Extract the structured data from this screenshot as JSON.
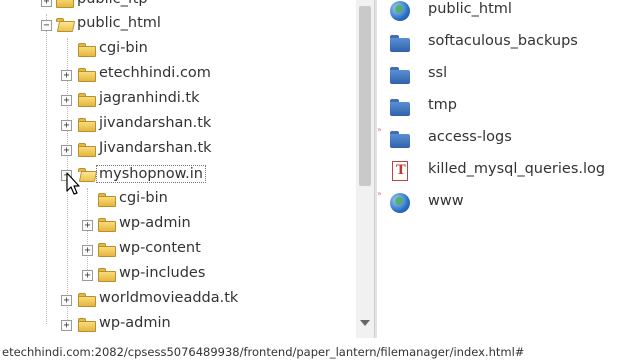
{
  "tree": {
    "items": [
      {
        "label": "public_ftp",
        "expander": "+",
        "open": false,
        "selected": false
      },
      {
        "label": "public_html",
        "expander": "−",
        "open": true,
        "selected": false
      },
      {
        "label": "cgi-bin",
        "expander": "",
        "open": false,
        "selected": false
      },
      {
        "label": "etechhindi.com",
        "expander": "+",
        "open": false,
        "selected": false
      },
      {
        "label": "jagranhindi.tk",
        "expander": "+",
        "open": false,
        "selected": false
      },
      {
        "label": "jivandarshan.tk",
        "expander": "+",
        "open": false,
        "selected": false
      },
      {
        "label": "Jivandarshan.tk",
        "expander": "+",
        "open": false,
        "selected": false
      },
      {
        "label": "myshopnow.in",
        "expander": "−",
        "open": true,
        "selected": true
      },
      {
        "label": "cgi-bin",
        "expander": "",
        "open": false,
        "selected": false
      },
      {
        "label": "wp-admin",
        "expander": "+",
        "open": false,
        "selected": false
      },
      {
        "label": "wp-content",
        "expander": "+",
        "open": false,
        "selected": false
      },
      {
        "label": "wp-includes",
        "expander": "+",
        "open": false,
        "selected": false
      },
      {
        "label": "worldmovieadda.tk",
        "expander": "+",
        "open": false,
        "selected": false
      },
      {
        "label": "wp-admin",
        "expander": "+",
        "open": false,
        "selected": false
      }
    ]
  },
  "files": {
    "items": [
      {
        "name": "public_html",
        "icon": "globe-icon",
        "marker": ""
      },
      {
        "name": "softaculous_backups",
        "icon": "folder-icon",
        "marker": ""
      },
      {
        "name": "ssl",
        "icon": "folder-icon",
        "marker": ""
      },
      {
        "name": "tmp",
        "icon": "folder-icon",
        "marker": ""
      },
      {
        "name": "access-logs",
        "icon": "folder-icon",
        "marker": "»"
      },
      {
        "name": "killed_mysql_queries.log",
        "icon": "text-file-icon",
        "marker": ""
      },
      {
        "name": "www",
        "icon": "globe-icon",
        "marker": "»"
      }
    ]
  },
  "status": {
    "url": "etechhindi.com:2082/cpsess5076489938/frontend/paper_lantern/filemanager/index.html#"
  },
  "colors": {
    "folder_yellow": "#f0c850",
    "folder_blue": "#3f6fb0",
    "text_file_red": "#c0392b"
  }
}
